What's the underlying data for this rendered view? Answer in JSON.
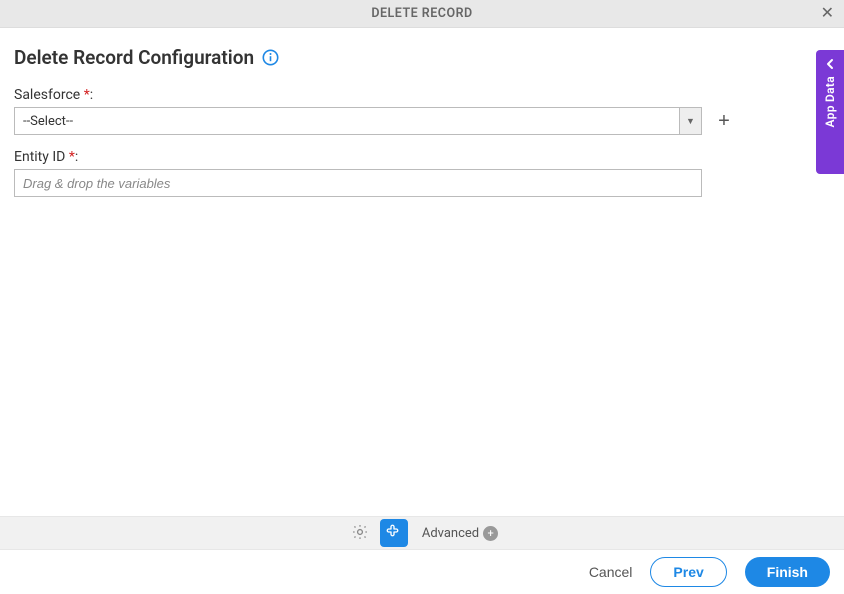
{
  "header": {
    "title": "DELETE RECORD"
  },
  "page": {
    "title": "Delete Record Configuration"
  },
  "fields": {
    "salesforce": {
      "label": "Salesforce",
      "required_mark": "*",
      "colon": ":",
      "selected": "--Select--"
    },
    "entity_id": {
      "label": "Entity ID",
      "required_mark": "*",
      "colon": ":",
      "value": "",
      "placeholder": "Drag & drop the variables"
    }
  },
  "side_tab": {
    "label": "App Data"
  },
  "toolbar": {
    "advanced_label": "Advanced"
  },
  "footer": {
    "cancel": "Cancel",
    "prev": "Prev",
    "finish": "Finish"
  }
}
